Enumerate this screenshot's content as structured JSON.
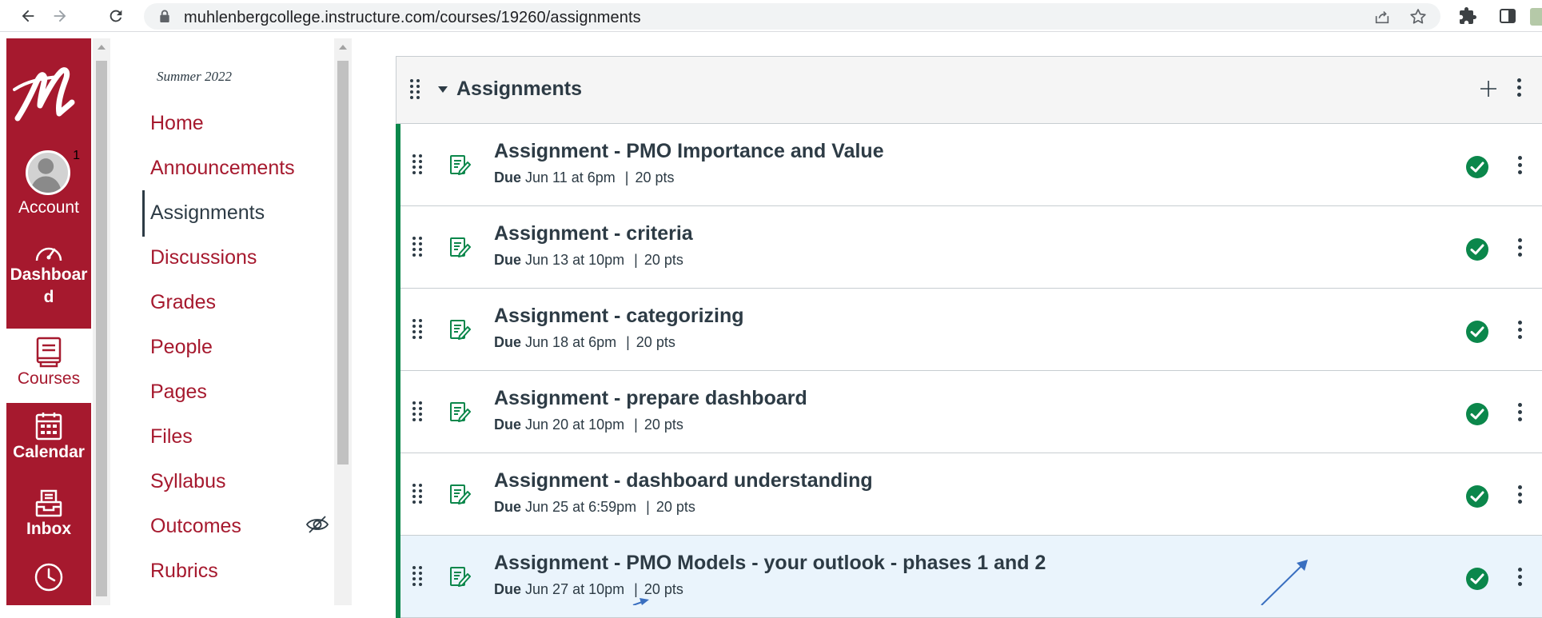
{
  "browser": {
    "url": "muhlenbergcollege.instructure.com/courses/19260/assignments"
  },
  "global_nav": {
    "account_label": "Account",
    "account_badge": "1",
    "dashboard_label": "Dashboard",
    "courses_label": "Courses",
    "calendar_label": "Calendar",
    "inbox_label": "Inbox",
    "brand_color": "#a6192e"
  },
  "course_nav": {
    "term": "Summer 2022",
    "items": [
      {
        "label": "Home"
      },
      {
        "label": "Announcements"
      },
      {
        "label": "Assignments"
      },
      {
        "label": "Discussions"
      },
      {
        "label": "Grades"
      },
      {
        "label": "People"
      },
      {
        "label": "Pages"
      },
      {
        "label": "Files"
      },
      {
        "label": "Syllabus"
      },
      {
        "label": "Outcomes"
      },
      {
        "label": "Rubrics"
      }
    ],
    "active_index": 2
  },
  "assignment_group": {
    "title": "Assignments",
    "assignments": [
      {
        "title": "Assignment - PMO Importance and Value",
        "due_label": "Due",
        "due": "Jun 11 at 6pm",
        "points": "20 pts"
      },
      {
        "title": "Assignment - criteria",
        "due_label": "Due",
        "due": "Jun 13 at 10pm",
        "points": "20 pts"
      },
      {
        "title": "Assignment - categorizing",
        "due_label": "Due",
        "due": "Jun 18 at 6pm",
        "points": "20 pts"
      },
      {
        "title": "Assignment - prepare dashboard",
        "due_label": "Due",
        "due": "Jun 20 at 10pm",
        "points": "20 pts"
      },
      {
        "title": "Assignment - dashboard understanding",
        "due_label": "Due",
        "due": "Jun 25 at 6:59pm",
        "points": "20 pts"
      },
      {
        "title": "Assignment - PMO Models - your outlook - phases 1 and 2",
        "due_label": "Due",
        "due": "Jun 27 at 10pm",
        "points": "20 pts"
      }
    ]
  },
  "colors": {
    "published_green": "#0b874b",
    "text_dark": "#2d3b45",
    "highlight_row": "#eaf4fc"
  }
}
